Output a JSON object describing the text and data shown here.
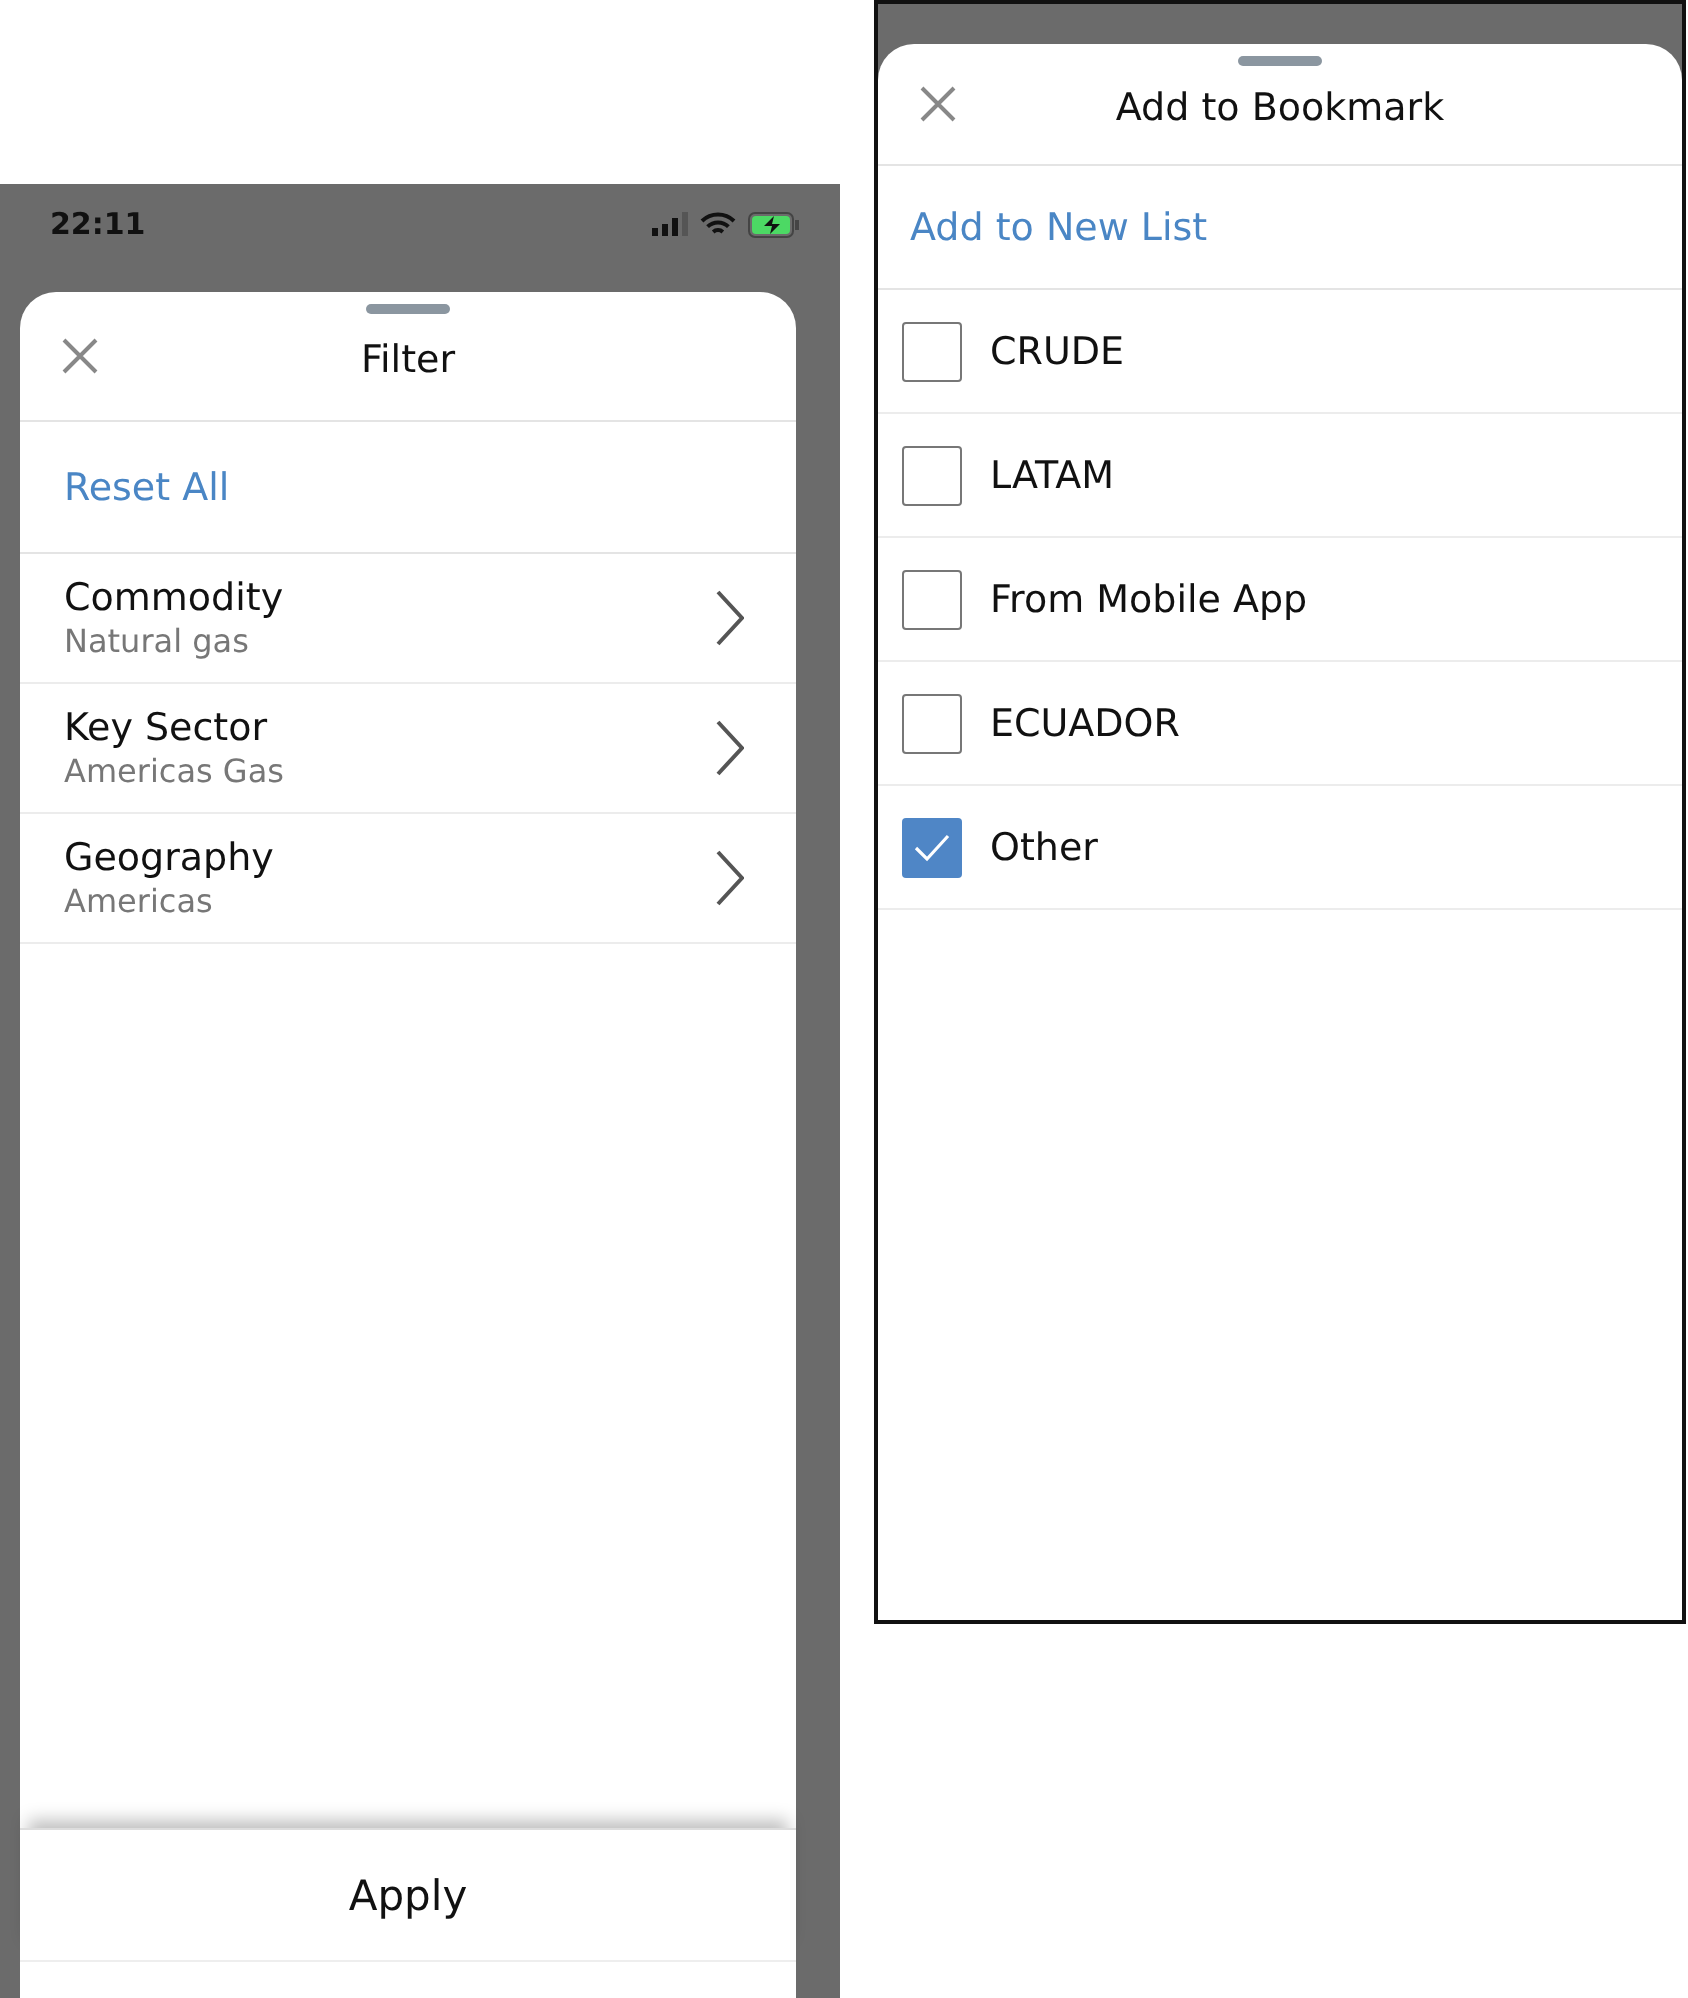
{
  "filter_screen": {
    "status_bar": {
      "time": "22:11"
    },
    "title": "Filter",
    "reset_link": "Reset All",
    "items": [
      {
        "label": "Commodity",
        "value": "Natural gas"
      },
      {
        "label": "Key Sector",
        "value": "Americas Gas"
      },
      {
        "label": "Geography",
        "value": "Americas"
      }
    ],
    "apply_button": "Apply"
  },
  "bookmark_screen": {
    "title": "Add to Bookmark",
    "new_list_link": "Add to New List",
    "lists": [
      {
        "label": "CRUDE",
        "checked": false
      },
      {
        "label": "LATAM",
        "checked": false
      },
      {
        "label": "From Mobile App",
        "checked": false
      },
      {
        "label": "ECUADOR",
        "checked": false
      },
      {
        "label": "Other",
        "checked": true
      }
    ]
  }
}
